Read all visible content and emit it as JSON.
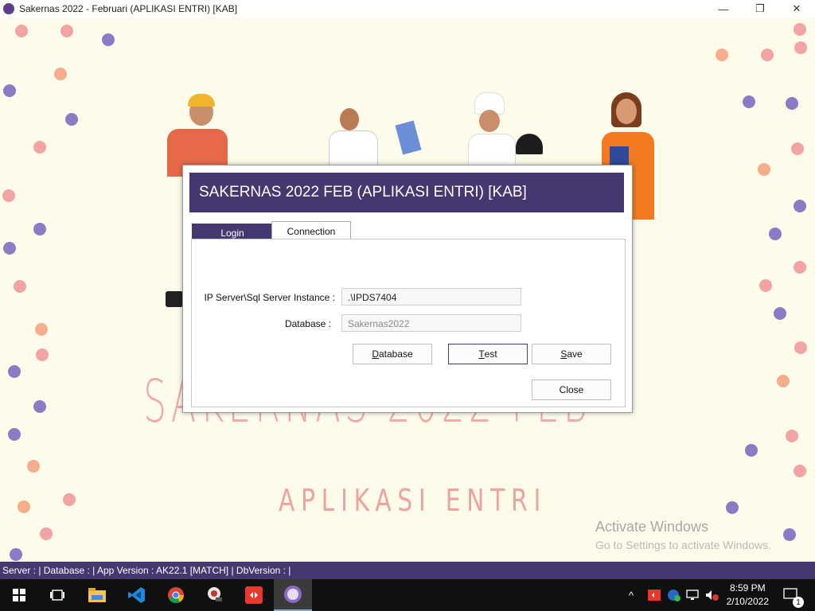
{
  "window": {
    "title": "Sakernas 2022 - Februari (APLIKASI ENTRI) [KAB]",
    "minimize": "—",
    "maximize": "❐",
    "close": "✕"
  },
  "background": {
    "title": "SAKERNAS 2022 FEB",
    "subtitle": "APLIKASI ENTRI",
    "activate_title": "Activate Windows",
    "activate_sub": "Go to Settings to activate Windows."
  },
  "dialog": {
    "header": "SAKERNAS 2022 FEB (APLIKASI ENTRI) [KAB]",
    "tabs": [
      {
        "label": "Login",
        "selected": false
      },
      {
        "label": "Connection",
        "selected": true
      }
    ],
    "server_label": "IP Server\\Sql Server Instance :",
    "server_value": ".\\IPDS7404",
    "database_label": "Database :",
    "database_value": "Sakernas2022",
    "buttons": {
      "database_first": "D",
      "database_rest": "atabase",
      "test_first": "T",
      "test_rest": "est",
      "save_first": "S",
      "save_rest": "ave",
      "close": "Close"
    }
  },
  "statusbar": {
    "text": "Server :  | Database :  | App Version : AK22.1 [MATCH] | DbVersion :  |"
  },
  "taskbar": {
    "time": "8:59 PM",
    "date": "2/10/2022",
    "notification_count": "1",
    "apps": [
      "start-icon",
      "task-view-icon",
      "file-explorer-icon",
      "vscode-icon",
      "chrome-icon",
      "app-icon",
      "anydesk-icon",
      "sakernas-icon"
    ]
  },
  "colors": {
    "accent": "#453770",
    "background": "#fdfbe9",
    "dot_purple": "#8a7bc4",
    "dot_pink": "#f2a3a3",
    "dot_orange": "#f5ad8b"
  }
}
